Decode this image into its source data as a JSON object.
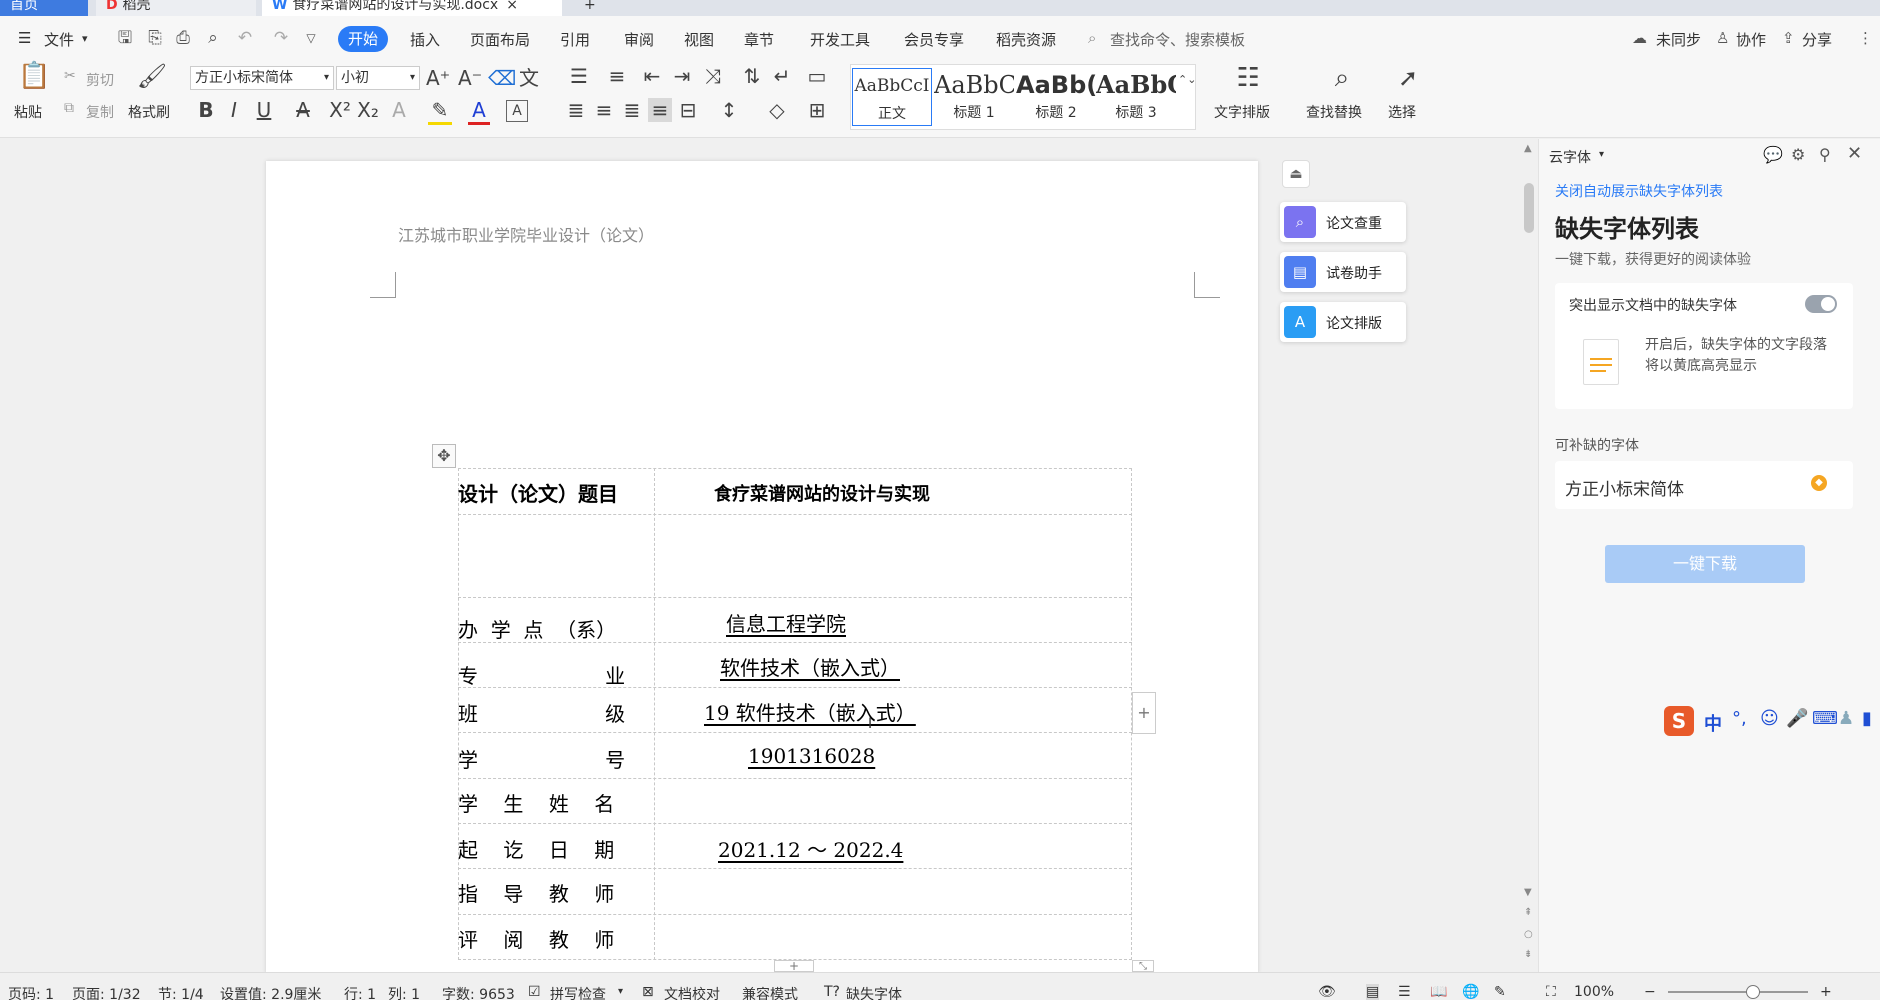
{
  "tabs": [
    {
      "label": "首页"
    },
    {
      "label": "稻壳"
    },
    {
      "label": "食疗菜谱网站的设计与实现.docx"
    }
  ],
  "menu": {
    "file": "文件",
    "items": [
      "开始",
      "插入",
      "页面布局",
      "引用",
      "审阅",
      "视图",
      "章节",
      "开发工具",
      "会员专享",
      "稻壳资源"
    ],
    "active": "开始",
    "search_placeholder": "查找命令、搜索模板",
    "sync": "未同步",
    "collab": "协作",
    "share": "分享"
  },
  "ribbon": {
    "paste": "粘贴",
    "cut": "剪切",
    "copy": "复制",
    "format_painter": "格式刷",
    "font_name": "方正小标宋简体",
    "font_size": "小初",
    "styles": [
      {
        "sample": "AaBbCcI",
        "name": "正文"
      },
      {
        "sample": "AaBbC",
        "name": "标题 1"
      },
      {
        "sample": "AaBb(",
        "name": "标题 2"
      },
      {
        "sample": "AaBbC",
        "name": "标题 3"
      }
    ],
    "text_layout": "文字排版",
    "find_replace": "查找替换",
    "select": "选择"
  },
  "document": {
    "header_text": "江苏城市职业学院毕业设计（论文）",
    "rows": [
      {
        "label": "设计（论文）题目",
        "value": "食疗菜谱网站的设计与实现"
      },
      {
        "label": "",
        "value": ""
      },
      {
        "label": "办  学  点  （系）",
        "value": "信息工程学院"
      },
      {
        "label": "专                    业",
        "value": "软件技术（嵌入式）"
      },
      {
        "label": "班                    级",
        "value": "19 软件技术（嵌入式）"
      },
      {
        "label": "学                    号",
        "value": "1901316028"
      },
      {
        "label": "学    生    姓    名",
        "value": ""
      },
      {
        "label": "起    讫    日    期",
        "value": "2021.12 ～ 2022.4"
      },
      {
        "label": "指    导    教    师",
        "value": ""
      },
      {
        "label": "评    阅    教    师",
        "value": ""
      }
    ]
  },
  "float_tools": [
    "论文查重",
    "试卷助手",
    "论文排版"
  ],
  "panel": {
    "title": "云字体",
    "close_auto_link": "关闭自动展示缺失字体列表",
    "heading": "缺失字体列表",
    "subheading": "一键下载，获得更好的阅读体验",
    "highlight_label": "突出显示文档中的缺失字体",
    "highlight_desc": "开启后，缺失字体的文字段落将以黄底高亮显示",
    "fonts_heading": "可补缺的字体",
    "missing_font": "方正小标宋简体",
    "download_btn": "一键下载"
  },
  "ime": {
    "lang": "中"
  },
  "status": {
    "page_no": "页码: 1",
    "page_of": "页面: 1/32",
    "section": "节: 1/4",
    "setting": "设置值: 2.9厘米",
    "row": "行: 1",
    "col": "列: 1",
    "word_count": "字数: 9653",
    "spell": "拼写检查",
    "doc_check": "文档校对",
    "compat": "兼容模式",
    "missing_font": "缺失字体",
    "zoom": "100%"
  },
  "colors": {
    "accent": "#2a7bf6",
    "panel_link": "#2a7bf6",
    "download_btn": "#a9cbf6"
  }
}
